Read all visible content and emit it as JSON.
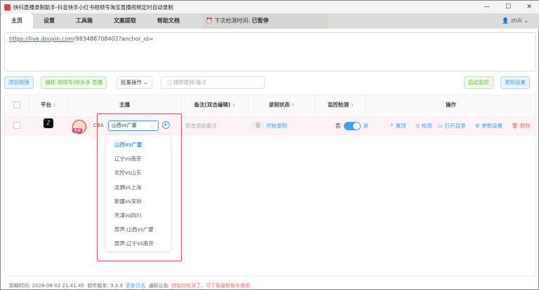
{
  "window": {
    "title": "快抖直播录制助手-抖音快手小红书视频号淘宝直播视频定时自动录制",
    "min": "—",
    "max": "☐",
    "close": "✕"
  },
  "tabs": [
    "主页",
    "设置",
    "工具箱",
    "文案提取",
    "帮助文档"
  ],
  "next_check": {
    "label": "下次检测时间:",
    "value": "已暂停"
  },
  "user": {
    "name": "zhili"
  },
  "url_input": {
    "link": "https://live.douyin.com",
    "rest": "/983488708402?anchor_id="
  },
  "toolbar": {
    "add_link": "添加链接",
    "capture": "捕获 视频号/拼多多 直播",
    "batch": "批量操作",
    "search_placeholder": "搜索昵称/备注",
    "start_monitor": "启动监控",
    "record_settings": "录制设置"
  },
  "table": {
    "headers": [
      "平台",
      "主播",
      "备注(双击编辑)",
      "录制状态",
      "监控检测",
      "操作"
    ],
    "row": {
      "live_badge": "直播",
      "anchor": "CBA",
      "selected": "山西vs广厦",
      "note": "双击添加备注",
      "status_no": "否",
      "start_record": "开始录制",
      "monitor_no": "否",
      "monitor_yes": "是",
      "actions": {
        "top": "置顶",
        "check": "检测",
        "open_dir": "打开目录",
        "params": "参数设置",
        "delete": "删除"
      }
    }
  },
  "dropdown_options": [
    "山西vs广厦",
    "辽宁vs南京",
    "北控vs山东",
    "龙狮vs上海",
    "新疆vs深圳",
    "天津vs四川",
    "原声:山西vs广厦",
    "原声:辽宁vs南京"
  ],
  "footer": {
    "expire_label": "到期时间:",
    "expire": "2026-08-02 21:41:45",
    "version_label": "软件版本:",
    "version": "3.3.3",
    "changelog": "更新日志",
    "notice_label": "通知公告:",
    "notice": "持监控检测了，可下载最新版本使用"
  },
  "colors": {
    "accent": "#409eff",
    "danger": "#f56c6c",
    "green": "#67c23a"
  }
}
